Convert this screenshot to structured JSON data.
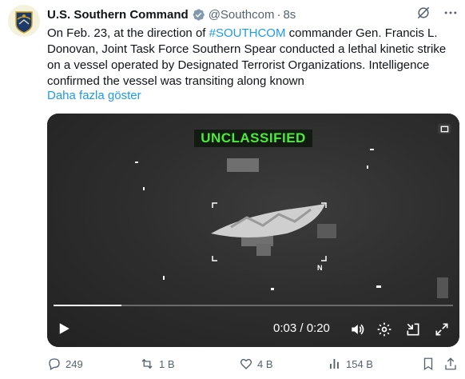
{
  "author": {
    "name": "U.S. Southern Command",
    "handle": "@Southcom",
    "separator": "·",
    "time": "8s"
  },
  "tweet": {
    "text_before": "On Feb. 23, at the direction of ",
    "hashtag": "#SOUTHCOM",
    "text_after": " commander Gen. Francis L. Donovan, Joint Task Force Southern Spear conducted a lethal kinetic strike on a vessel operated by Designated Terrorist Organizations. Intelligence confirmed the vessel was transiting along known",
    "show_more": "Daha fazla göster"
  },
  "video": {
    "overlay_label": "UNCLASSIFIED",
    "marker": "N",
    "timecode": "0:03 / 0:20",
    "progress": 0.17
  },
  "actions": {
    "replies": "249",
    "reposts": "1 B",
    "likes": "4 B",
    "views": "154 B"
  },
  "colors": {
    "accent": "#1d9bf0",
    "overlay_text": "#49ec36",
    "muted": "#536471"
  }
}
